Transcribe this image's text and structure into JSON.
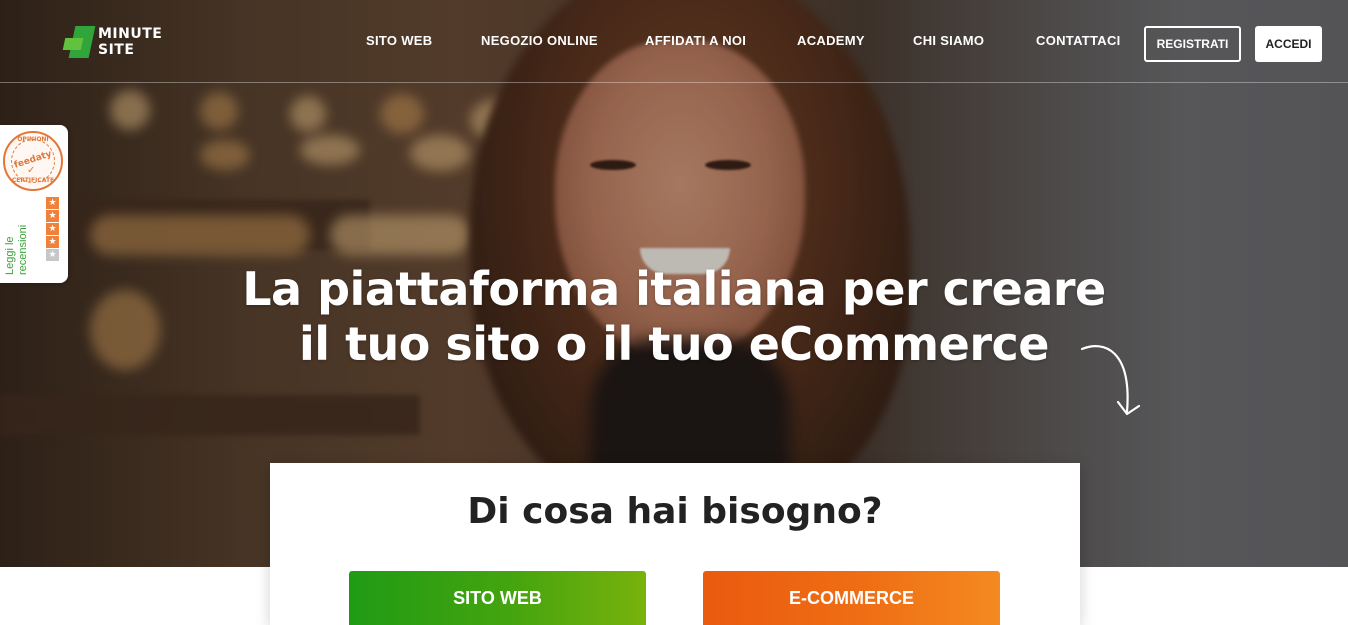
{
  "logo": {
    "line1": "MINUTE",
    "line2": "SITE"
  },
  "nav": {
    "items": [
      {
        "label": "SITO WEB"
      },
      {
        "label": "NEGOZIO ONLINE"
      },
      {
        "label": "AFFIDATI A NOI"
      },
      {
        "label": "ACADEMY"
      },
      {
        "label": "CHI SIAMO"
      },
      {
        "label": "CONTATTACI"
      }
    ],
    "register_label": "REGISTRATI",
    "login_label": "ACCEDI"
  },
  "feedaty": {
    "seal_top": "OPINIONI",
    "seal_brand": "feedaty",
    "seal_bottom": "CERTIFICATE",
    "read_reviews_line1": "Leggi le",
    "read_reviews_line2": "recensioni",
    "rating_stars": 4,
    "max_stars": 5
  },
  "hero": {
    "headline_line1": "La piattaforma italiana per creare",
    "headline_line2": "il tuo sito o il tuo eCommerce"
  },
  "choice": {
    "title": "Di cosa hai bisogno?",
    "option_website": "SITO WEB",
    "option_ecommerce": "E-COMMERCE"
  },
  "colors": {
    "brand_green": "#2fa53a",
    "website_button_gradient": [
      "#1f9b14",
      "#79b20c"
    ],
    "ecommerce_button_gradient": [
      "#ea5a0f",
      "#f48a20"
    ],
    "feedaty_orange": "#e2773a"
  },
  "icons": [
    "minute-site-logo-icon",
    "feedaty-seal-icon",
    "star-icon",
    "curved-arrow-down-icon"
  ]
}
